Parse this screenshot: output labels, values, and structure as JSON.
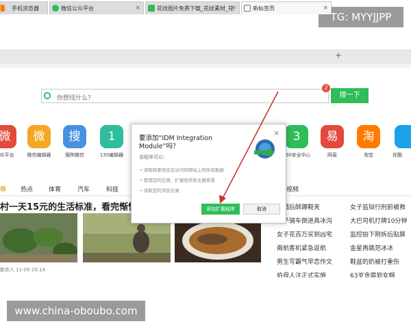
{
  "watermarks": {
    "top": "TG: MYYJJPP",
    "bottom": "www.china-oboubo.com"
  },
  "tabs": [
    {
      "label": "手机浏览器",
      "color": "#ff7a00"
    },
    {
      "label": "微信公众平台",
      "color": "#2ebd59"
    },
    {
      "label": "花纹图片免费下载_花纹素材_花",
      "color": "#2ebd59"
    },
    {
      "label": "新标签页",
      "color": "#777777"
    }
  ],
  "tab_close": "×",
  "new_tab": "+",
  "search": {
    "placeholder": "你想找什么？",
    "button": "搜一下",
    "badge": "2"
  },
  "apps": [
    {
      "glyph": "微",
      "label": "众平台",
      "color": "#e14a3c"
    },
    {
      "glyph": "微",
      "label": "微信编辑器",
      "color": "#f5a623"
    },
    {
      "glyph": "搜",
      "label": "搜狗微信",
      "color": "#4a90e2"
    },
    {
      "glyph": "1",
      "label": "135编辑器",
      "color": "#2ebd9e"
    },
    {
      "glyph": "3",
      "label": "360安全中心",
      "color": "#2ebd59"
    },
    {
      "glyph": "易",
      "label": "网易",
      "color": "#e14a3c"
    },
    {
      "glyph": "淘",
      "label": "淘宝",
      "color": "#ff7a00"
    },
    {
      "glyph": "",
      "label": "优酷",
      "color": "#1aa3e8"
    }
  ],
  "categories": [
    "荐",
    "热点",
    "体育",
    "汽车",
    "科技",
    "视频"
  ],
  "headline": "村一天15元的生活标准，看完惭愧!",
  "article_meta": "新农人   11-05 20:14",
  "news_left": [
    "平酒后醉蹲鞋夹",
    "女子骑车倒进具冰沟",
    "女子花百万买到凶宅",
    "南航客机紧急返航",
    "男生写霸气早恋作文",
    "伯母人注正式实施"
  ],
  "news_right": [
    "女子监狱行刑前被救",
    "大巴司机打牌10分钟",
    "监控拍下刚拆后贴屏",
    "金星再跳范冰冰",
    "鞋盆的奶被打重伤",
    "63岁贪腐到女帽"
  ],
  "dialog": {
    "title": "要添加“IDM Integration Module”吗？",
    "subtitle": "该程序可以：",
    "permissions": [
      "读取和更改您在访问的网站上的所有数据",
      "管理您的应用、扩展程序和主题背景",
      "读取您的浏览记录"
    ],
    "ok": "添加扩展程序",
    "cancel": "取消",
    "close": "×"
  },
  "colors": {
    "accent_green": "#2ebd59",
    "arrow_red": "#c0392b"
  }
}
